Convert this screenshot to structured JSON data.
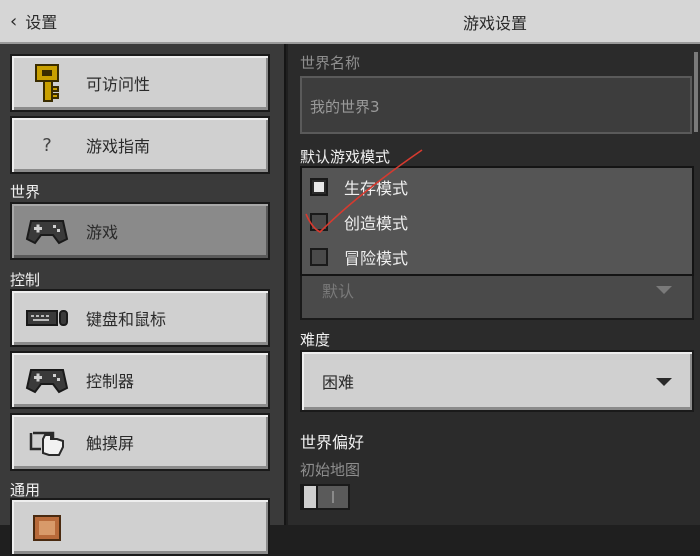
{
  "header": {
    "back_label": "设置",
    "title": "游戏设置"
  },
  "sidebar": {
    "top_items": [
      {
        "label": "可访问性",
        "icon": "key-icon"
      },
      {
        "label": "游戏指南",
        "icon": "question-icon"
      }
    ],
    "sections": [
      {
        "title": "世界",
        "items": [
          {
            "label": "游戏",
            "icon": "gamepad-icon",
            "selected": true
          }
        ]
      },
      {
        "title": "控制",
        "items": [
          {
            "label": "键盘和鼠标",
            "icon": "keyboard-mouse-icon"
          },
          {
            "label": "控制器",
            "icon": "controller-icon"
          },
          {
            "label": "触摸屏",
            "icon": "touch-icon"
          }
        ]
      },
      {
        "title": "通用",
        "items": [
          {
            "label": "",
            "icon": "settings-partial-icon"
          }
        ]
      }
    ]
  },
  "main": {
    "world_name_label": "世界名称",
    "world_name_value": "我的世界3",
    "default_mode_label": "默认游戏模式",
    "default_mode_value": "默认",
    "mode_options": [
      {
        "label": "生存模式",
        "checked": true
      },
      {
        "label": "创造模式",
        "checked": false
      },
      {
        "label": "冒险模式",
        "checked": false
      }
    ],
    "difficulty_label": "难度",
    "difficulty_value": "困难",
    "world_prefs_label": "世界偏好",
    "starting_map_label": "初始地图",
    "starting_map_enabled": false
  },
  "colors": {
    "button_face": "#d0d0d0",
    "button_selected": "#8a8a8a",
    "panel_bg": "#2b2b2b",
    "annotation_red": "#d63a2f"
  }
}
